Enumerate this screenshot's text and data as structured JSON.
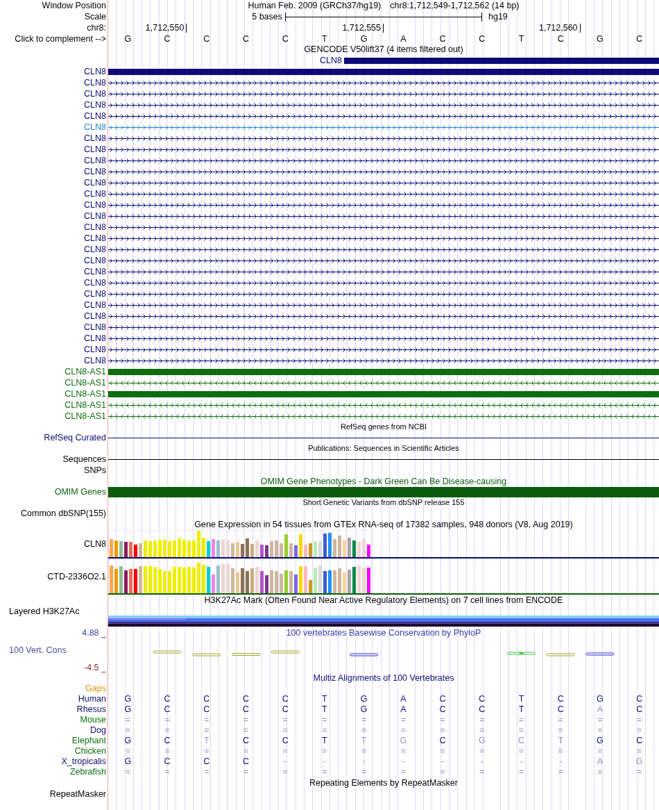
{
  "ruler": {
    "window_label": "Window Position",
    "assembly": "Human Feb. 2009 (GRCh37/hg19)",
    "position": "chr8:1,712,549-1,712,562 (14 bp)",
    "scale_label": "Scale",
    "scale": "5 bases",
    "database": "hg19",
    "chrom_label": "chr8:",
    "ticks": [
      "1,712,550",
      "1,712,555",
      "1,712,560"
    ],
    "complement_label": "Click to complement -->",
    "bases": [
      "G",
      "C",
      "C",
      "C",
      "C",
      "T",
      "G",
      "A",
      "C",
      "C",
      "T",
      "C",
      "G",
      "C"
    ]
  },
  "tracks": [
    {
      "kind": "genes",
      "title": "GENCODE V50lift37 (4 items filtered out)",
      "color": "#000000",
      "rows": [
        {
          "label": "CLN8",
          "kind": "block",
          "color": "#0c0c78",
          "level": 0.5714
        },
        {
          "label": "CLN8",
          "kind": "block",
          "color": "#0c0c78"
        },
        {
          "label": "CLN8",
          "kind": "forward",
          "color": "#0c0c78"
        },
        {
          "label": "CLN8",
          "kind": "forward",
          "color": "#0c0c78"
        },
        {
          "label": "CLN8",
          "kind": "forward",
          "color": "#0c0c78"
        },
        {
          "label": "CLN8",
          "kind": "forward",
          "color": "#0c0c78"
        },
        {
          "label": "CLN8",
          "kind": "forward",
          "color": "#1e82c8"
        },
        {
          "label": "CLN8",
          "kind": "forward",
          "color": "#0c0c78"
        },
        {
          "label": "CLN8",
          "kind": "forward",
          "color": "#0c0c78"
        },
        {
          "label": "CLN8",
          "kind": "forward",
          "color": "#0c0c78"
        },
        {
          "label": "CLN8",
          "kind": "forward",
          "color": "#0c0c78"
        },
        {
          "label": "CLN8",
          "kind": "forward",
          "color": "#0c0c78"
        },
        {
          "label": "CLN8",
          "kind": "forward",
          "color": "#0c0c78"
        },
        {
          "label": "CLN8",
          "kind": "forward",
          "color": "#0c0c78"
        },
        {
          "label": "CLN8",
          "kind": "forward",
          "color": "#0c0c78"
        },
        {
          "label": "CLN8",
          "kind": "forward",
          "color": "#0c0c78"
        },
        {
          "label": "CLN8",
          "kind": "forward",
          "color": "#0c0c78"
        },
        {
          "label": "CLN8",
          "kind": "forward",
          "color": "#0c0c78"
        },
        {
          "label": "CLN8",
          "kind": "forward",
          "color": "#0c0c78"
        },
        {
          "label": "CLN8",
          "kind": "forward",
          "color": "#0c0c78"
        },
        {
          "label": "CLN8",
          "kind": "forward",
          "color": "#0c0c78"
        },
        {
          "label": "CLN8",
          "kind": "forward",
          "color": "#0c0c78"
        },
        {
          "label": "CLN8",
          "kind": "forward",
          "color": "#0c0c78"
        },
        {
          "label": "CLN8",
          "kind": "forward",
          "color": "#0c0c78"
        },
        {
          "label": "CLN8",
          "kind": "forward",
          "color": "#0c0c78"
        },
        {
          "label": "CLN8",
          "kind": "forward",
          "color": "#0c0c78"
        },
        {
          "label": "CLN8",
          "kind": "forward",
          "color": "#0c0c78"
        },
        {
          "label": "CLN8",
          "kind": "forward",
          "color": "#0c0c78"
        },
        {
          "label": "CLN8-AS1",
          "kind": "block",
          "color": "#0e6e0e"
        },
        {
          "label": "CLN8-AS1",
          "kind": "reverse",
          "color": "#0e6e0e"
        },
        {
          "label": "CLN8-AS1",
          "kind": "block",
          "color": "#0e6e0e"
        },
        {
          "label": "CLN8-AS1",
          "kind": "reverse",
          "color": "#0e6e0e"
        },
        {
          "label": "CLN8-AS1",
          "kind": "reverse",
          "color": "#0e6e0e"
        }
      ]
    },
    {
      "kind": "dense",
      "title": "RefSeq genes from NCBI",
      "color": "#000000",
      "rows": [
        {
          "label": "RefSeq Curated",
          "kind": "line",
          "color": "#0c0c78"
        }
      ]
    },
    {
      "kind": "dense",
      "title": "Publications: Sequences in Scientific Articles",
      "color": "#000000",
      "rows": [
        {
          "label": "Sequences",
          "kind": "line",
          "color": "#000000"
        },
        {
          "label": "SNPs",
          "kind": "empty",
          "color": "#000000"
        }
      ]
    },
    {
      "kind": "omim",
      "title": "OMIM Gene Phenotypes - Dark Green Can Be Disease-causing",
      "color": "#0b5d0b",
      "rows": [
        {
          "label": "OMIM Genes",
          "kind": "bar",
          "color": "#0b5d0b"
        }
      ]
    },
    {
      "kind": "dense",
      "title": "Short Genetic Variants from dbSNP release 155",
      "color": "#000000",
      "rows": [
        {
          "label": "Common dbSNP(155)",
          "kind": "empty",
          "color": "#000000"
        }
      ]
    },
    {
      "kind": "gtex",
      "title": "Gene Expression in 54 tissues from GTEx RNA-seq of 17382 samples, 948 donors (V8, Aug 2019)",
      "color": "#000000",
      "rows": [
        {
          "label": "CLN8",
          "kind": "expression",
          "color": "#0c0c78"
        },
        {
          "label": "CTD-2336O2.1",
          "kind": "expression",
          "color": "#0b5d0b"
        }
      ]
    },
    {
      "kind": "layered",
      "title": "H3K27Ac Mark (Often Found Near Active Regulatory Elements) on 7 cell lines from ENCODE",
      "color": "#000000",
      "rows": [
        {
          "label": "Layered H3K27Ac",
          "kind": "layers",
          "color": "#000000"
        }
      ]
    },
    {
      "kind": "wiggle",
      "title": "100 vertebrates Basewise Conservation by PhyloP",
      "color": "#3c3ca8",
      "rows": [
        {
          "label": "100 Vert. Cons",
          "kind": "wiggle",
          "color": "#4d4d9c",
          "max_label": "4.88 _",
          "min_label": "-4.5 _"
        }
      ]
    },
    {
      "kind": "multiz",
      "title": "Multiz Alignments of 100 Vertebrates",
      "color": "#0c0c78",
      "rows": [
        {
          "label": "Gaps",
          "kind": "empty",
          "color": "#e0900a"
        },
        {
          "label": "Human",
          "kind": "alignment",
          "color": "#0c0c78",
          "bases": [
            {
              "text": "G",
              "dim": false
            },
            {
              "text": "C",
              "dim": false
            },
            {
              "text": "C",
              "dim": false
            },
            {
              "text": "C",
              "dim": false
            },
            {
              "text": "C",
              "dim": false
            },
            {
              "text": "T",
              "dim": false
            },
            {
              "text": "G",
              "dim": false
            },
            {
              "text": "A",
              "dim": false
            },
            {
              "text": "C",
              "dim": false
            },
            {
              "text": "C",
              "dim": false
            },
            {
              "text": "T",
              "dim": false
            },
            {
              "text": "C",
              "dim": false
            },
            {
              "text": "G",
              "dim": false
            },
            {
              "text": "C",
              "dim": false
            }
          ]
        },
        {
          "label": "Rhesus",
          "kind": "alignment",
          "color": "#0c0c78",
          "bases": [
            {
              "text": "G",
              "dim": false
            },
            {
              "text": "C",
              "dim": false
            },
            {
              "text": "C",
              "dim": false
            },
            {
              "text": "C",
              "dim": false
            },
            {
              "text": "C",
              "dim": false
            },
            {
              "text": "T",
              "dim": false
            },
            {
              "text": "G",
              "dim": false
            },
            {
              "text": "A",
              "dim": false
            },
            {
              "text": "C",
              "dim": false
            },
            {
              "text": "C",
              "dim": false
            },
            {
              "text": "T",
              "dim": false
            },
            {
              "text": "C",
              "dim": false
            },
            {
              "text": "A",
              "dim": true
            },
            {
              "text": "C",
              "dim": false
            }
          ]
        },
        {
          "label": "Mouse",
          "kind": "alignment",
          "color": "#0e6e0e",
          "bases": [
            {
              "text": "=",
              "dim": true
            },
            {
              "text": "=",
              "dim": true
            },
            {
              "text": "=",
              "dim": true
            },
            {
              "text": "=",
              "dim": true
            },
            {
              "text": "=",
              "dim": true
            },
            {
              "text": "=",
              "dim": true
            },
            {
              "text": "=",
              "dim": true
            },
            {
              "text": "=",
              "dim": true
            },
            {
              "text": "=",
              "dim": true
            },
            {
              "text": "=",
              "dim": true
            },
            {
              "text": "=",
              "dim": true
            },
            {
              "text": "=",
              "dim": true
            },
            {
              "text": "=",
              "dim": true
            },
            {
              "text": "=",
              "dim": true
            }
          ]
        },
        {
          "label": "Dog",
          "kind": "alignment",
          "color": "#0c0c78",
          "bases": [
            {
              "text": "=",
              "dim": true
            },
            {
              "text": "=",
              "dim": true
            },
            {
              "text": "=",
              "dim": true
            },
            {
              "text": "=",
              "dim": true
            },
            {
              "text": "=",
              "dim": true
            },
            {
              "text": "=",
              "dim": true
            },
            {
              "text": "=",
              "dim": true
            },
            {
              "text": "=",
              "dim": true
            },
            {
              "text": "=",
              "dim": true
            },
            {
              "text": "=",
              "dim": true
            },
            {
              "text": "=",
              "dim": true
            },
            {
              "text": "=",
              "dim": true
            },
            {
              "text": "=",
              "dim": true
            },
            {
              "text": "=",
              "dim": true
            }
          ]
        },
        {
          "label": "Elephant",
          "kind": "alignment",
          "color": "#0e6e0e",
          "bases": [
            {
              "text": "G",
              "dim": false
            },
            {
              "text": "C",
              "dim": false
            },
            {
              "text": "T",
              "dim": true
            },
            {
              "text": "C",
              "dim": false
            },
            {
              "text": "C",
              "dim": false
            },
            {
              "text": "T",
              "dim": false
            },
            {
              "text": "T",
              "dim": true
            },
            {
              "text": "G",
              "dim": true
            },
            {
              "text": "C",
              "dim": false
            },
            {
              "text": "G",
              "dim": true
            },
            {
              "text": "C",
              "dim": true
            },
            {
              "text": "T",
              "dim": true
            },
            {
              "text": "G",
              "dim": false
            },
            {
              "text": "C",
              "dim": false
            }
          ]
        },
        {
          "label": "Chicken",
          "kind": "alignment",
          "color": "#0e6e0e",
          "bases": [
            {
              "text": "=",
              "dim": true
            },
            {
              "text": "=",
              "dim": true
            },
            {
              "text": "=",
              "dim": true
            },
            {
              "text": "=",
              "dim": true
            },
            {
              "text": "=",
              "dim": true
            },
            {
              "text": "=",
              "dim": true
            },
            {
              "text": "=",
              "dim": true
            },
            {
              "text": "=",
              "dim": true
            },
            {
              "text": "=",
              "dim": true
            },
            {
              "text": "=",
              "dim": true
            },
            {
              "text": "=",
              "dim": true
            },
            {
              "text": "=",
              "dim": true
            },
            {
              "text": "=",
              "dim": true
            },
            {
              "text": "=",
              "dim": true
            }
          ]
        },
        {
          "label": "X_tropicalis",
          "kind": "alignment",
          "color": "#0c0c78",
          "bases": [
            {
              "text": "G",
              "dim": false
            },
            {
              "text": "C",
              "dim": false
            },
            {
              "text": "C",
              "dim": false
            },
            {
              "text": "C",
              "dim": false
            },
            {
              "text": "-",
              "dim": true
            },
            {
              "text": "-",
              "dim": true
            },
            {
              "text": "-",
              "dim": true
            },
            {
              "text": "-",
              "dim": true
            },
            {
              "text": "-",
              "dim": true
            },
            {
              "text": "-",
              "dim": true
            },
            {
              "text": "-",
              "dim": true
            },
            {
              "text": "-",
              "dim": true
            },
            {
              "text": "A",
              "dim": true
            },
            {
              "text": "G",
              "dim": true
            }
          ]
        },
        {
          "label": "Zebrafish",
          "kind": "alignment",
          "color": "#0e6e0e",
          "bases": [
            {
              "text": "=",
              "dim": true
            },
            {
              "text": "=",
              "dim": true
            },
            {
              "text": "=",
              "dim": true
            },
            {
              "text": "=",
              "dim": true
            },
            {
              "text": "=",
              "dim": true
            },
            {
              "text": "=",
              "dim": true
            },
            {
              "text": "=",
              "dim": true
            },
            {
              "text": "=",
              "dim": true
            },
            {
              "text": "=",
              "dim": true
            },
            {
              "text": "=",
              "dim": true
            },
            {
              "text": "=",
              "dim": true
            },
            {
              "text": "=",
              "dim": true
            },
            {
              "text": "=",
              "dim": true
            },
            {
              "text": "=",
              "dim": true
            }
          ]
        }
      ]
    },
    {
      "kind": "repeats",
      "title": "Repeating Elements by RepeatMasker",
      "color": "#000000",
      "rows": [
        {
          "label": "RepeatMasker",
          "kind": "empty",
          "color": "#000000"
        }
      ]
    }
  ]
}
